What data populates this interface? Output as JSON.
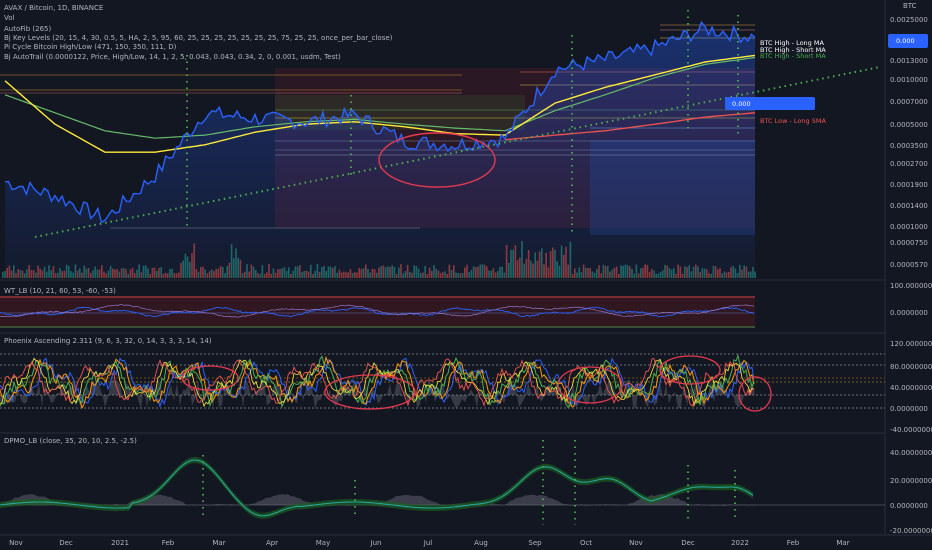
{
  "header": {
    "title": "AVAX / Bitcoin, 1D, BINANCE",
    "vol": "Vol",
    "autofib": "AutoFib (265)",
    "keylevels": "Bj Key Levels (20, 15, 4, 30, 0.5, 5, HA, 2, 5, 95, 60, 25, 25, 25, 25, 25, 25, 25, 75, 25, 25, once_per_bar_close)",
    "picycle": "Pi Cycle Bitcoin High/Low (471, 150, 350, 111, D)",
    "autotrail": "Bj AutoTrail (0.0000122, Price, High/Low, 14, 1, 2, 5, 0.043, 0.043, 0.34, 2, 0, 0.001, usdm, Test)"
  },
  "panes": {
    "wt": "WT_LB (10, 21, 60, 53, -60, -53)",
    "phoenix": "Phoenix Ascending 2.311 (9, 6, 3, 32, 0, 14, 3, 3, 3, 14, 14)",
    "dpmo": "DPMO_LB (close, 35, 20, 10, 2.5, -2.5)"
  },
  "tags": {
    "long_ma": "BTC High - Long MA",
    "short_ma": "BTC High - Short MA",
    "low_sma": "BTC Low - Long SMA",
    "marker_value": "0.000",
    "last_price": "0.000"
  },
  "axis": {
    "currency": "BTC",
    "price_ticks": [
      "0.0025000",
      "0.0019000",
      "0.0013000",
      "0.0010000",
      "0.0007000",
      "0.0005000",
      "0.0003500",
      "0.0002700",
      "0.0001900",
      "0.0001400",
      "0.0001000",
      "0.0000750",
      "0.0000570"
    ],
    "wt_ticks": [
      "100.0000000",
      "0.0000000"
    ],
    "phoenix_ticks": [
      "120.0000000",
      "80.0000000",
      "40.0000000",
      "0.0000000",
      "-40.0000000"
    ],
    "dpmo_ticks": [
      "40.0000000",
      "20.0000000",
      "0.0000000",
      "-20.0000000"
    ],
    "time_ticks": [
      "Nov",
      "Dec",
      "2021",
      "Feb",
      "Mar",
      "Apr",
      "May",
      "Jun",
      "Jul",
      "Aug",
      "Sep",
      "Oct",
      "Nov",
      "Dec",
      "2022",
      "Feb",
      "Mar"
    ]
  },
  "chart_data": {
    "type": "line",
    "title": "AVAX / Bitcoin, 1D, BINANCE",
    "xlabel": "",
    "ylabel": "",
    "log_scale": true,
    "x": [
      "2020-10",
      "2020-11",
      "2020-12",
      "2021-01",
      "2021-02",
      "2021-03",
      "2021-04",
      "2021-05",
      "2021-06",
      "2021-07",
      "2021-08",
      "2021-09",
      "2021-10",
      "2021-11",
      "2021-12",
      "2022-01"
    ],
    "series": [
      {
        "name": "",
        "values": [
          0.0002,
          0.00016,
          0.00011,
          0.00022,
          0.0006,
          0.00055,
          0.00052,
          0.00058,
          0.00038,
          0.00036,
          0.0004,
          0.0012,
          0.0014,
          0.0017,
          0.0023,
          0.002
        ]
      },
      {
        "name": "BTC High - Short MA",
        "values": [
          0.001,
          0.0005,
          0.00032,
          0.00032,
          0.00036,
          0.00044,
          0.0005,
          0.00052,
          0.00048,
          0.00043,
          0.00042,
          0.0007,
          0.0009,
          0.0011,
          0.00135,
          0.0015
        ]
      },
      {
        "name": "BTC High - Long MA",
        "values": [
          0.0008,
          0.0006,
          0.00045,
          0.0004,
          0.00042,
          0.00048,
          0.00052,
          0.00054,
          0.0005,
          0.00047,
          0.00045,
          0.00062,
          0.0008,
          0.00105,
          0.0013,
          0.00145
        ]
      },
      {
        "name": "BTC Low - Long SMA",
        "values": [
          null,
          null,
          null,
          null,
          null,
          null,
          null,
          null,
          null,
          null,
          0.00039,
          0.00042,
          0.00045,
          0.0005,
          0.00056,
          0.0006
        ]
      }
    ],
    "ylim": [
      4.5e-05,
      0.003
    ]
  }
}
